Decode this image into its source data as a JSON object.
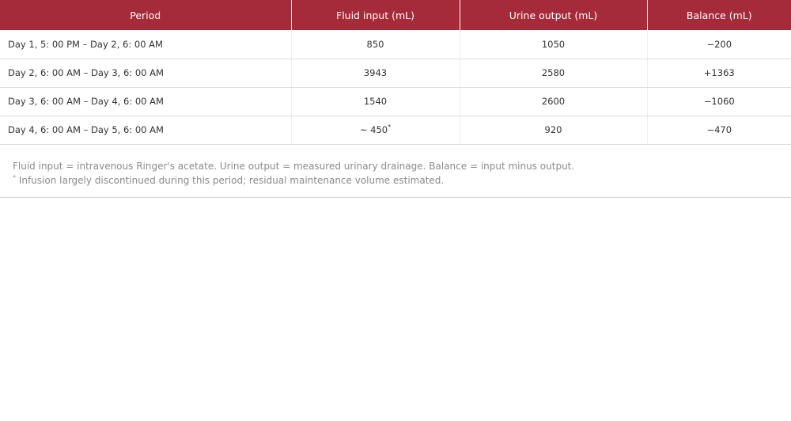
{
  "table": {
    "headers": [
      "Period",
      "Fluid input (mL)",
      "Urine output (mL)",
      "Balance (mL)"
    ],
    "rows": [
      {
        "period": "Day 1, 5: 00 PM – Day 2, 6: 00 AM",
        "input": "850",
        "input_mark": "",
        "output": "1050",
        "balance": "−200"
      },
      {
        "period": "Day 2, 6: 00 AM – Day 3, 6: 00 AM",
        "input": "3943",
        "input_mark": "",
        "output": "2580",
        "balance": "+1363"
      },
      {
        "period": "Day 3, 6: 00 AM – Day 4, 6: 00 AM",
        "input": "1540",
        "input_mark": "",
        "output": "2600",
        "balance": "−1060"
      },
      {
        "period": "Day 4, 6: 00 AM – Day 5, 6: 00 AM",
        "input": "~ 450",
        "input_mark": "*",
        "output": "920",
        "balance": "−470"
      }
    ]
  },
  "footnotes": {
    "note1": "Fluid input = intravenous Ringer's acetate. Urine output = measured urinary drainage. Balance = input minus output.",
    "note2_mark": "*",
    "note2": " Infusion largely discontinued during this period; residual maintenance volume estimated."
  }
}
